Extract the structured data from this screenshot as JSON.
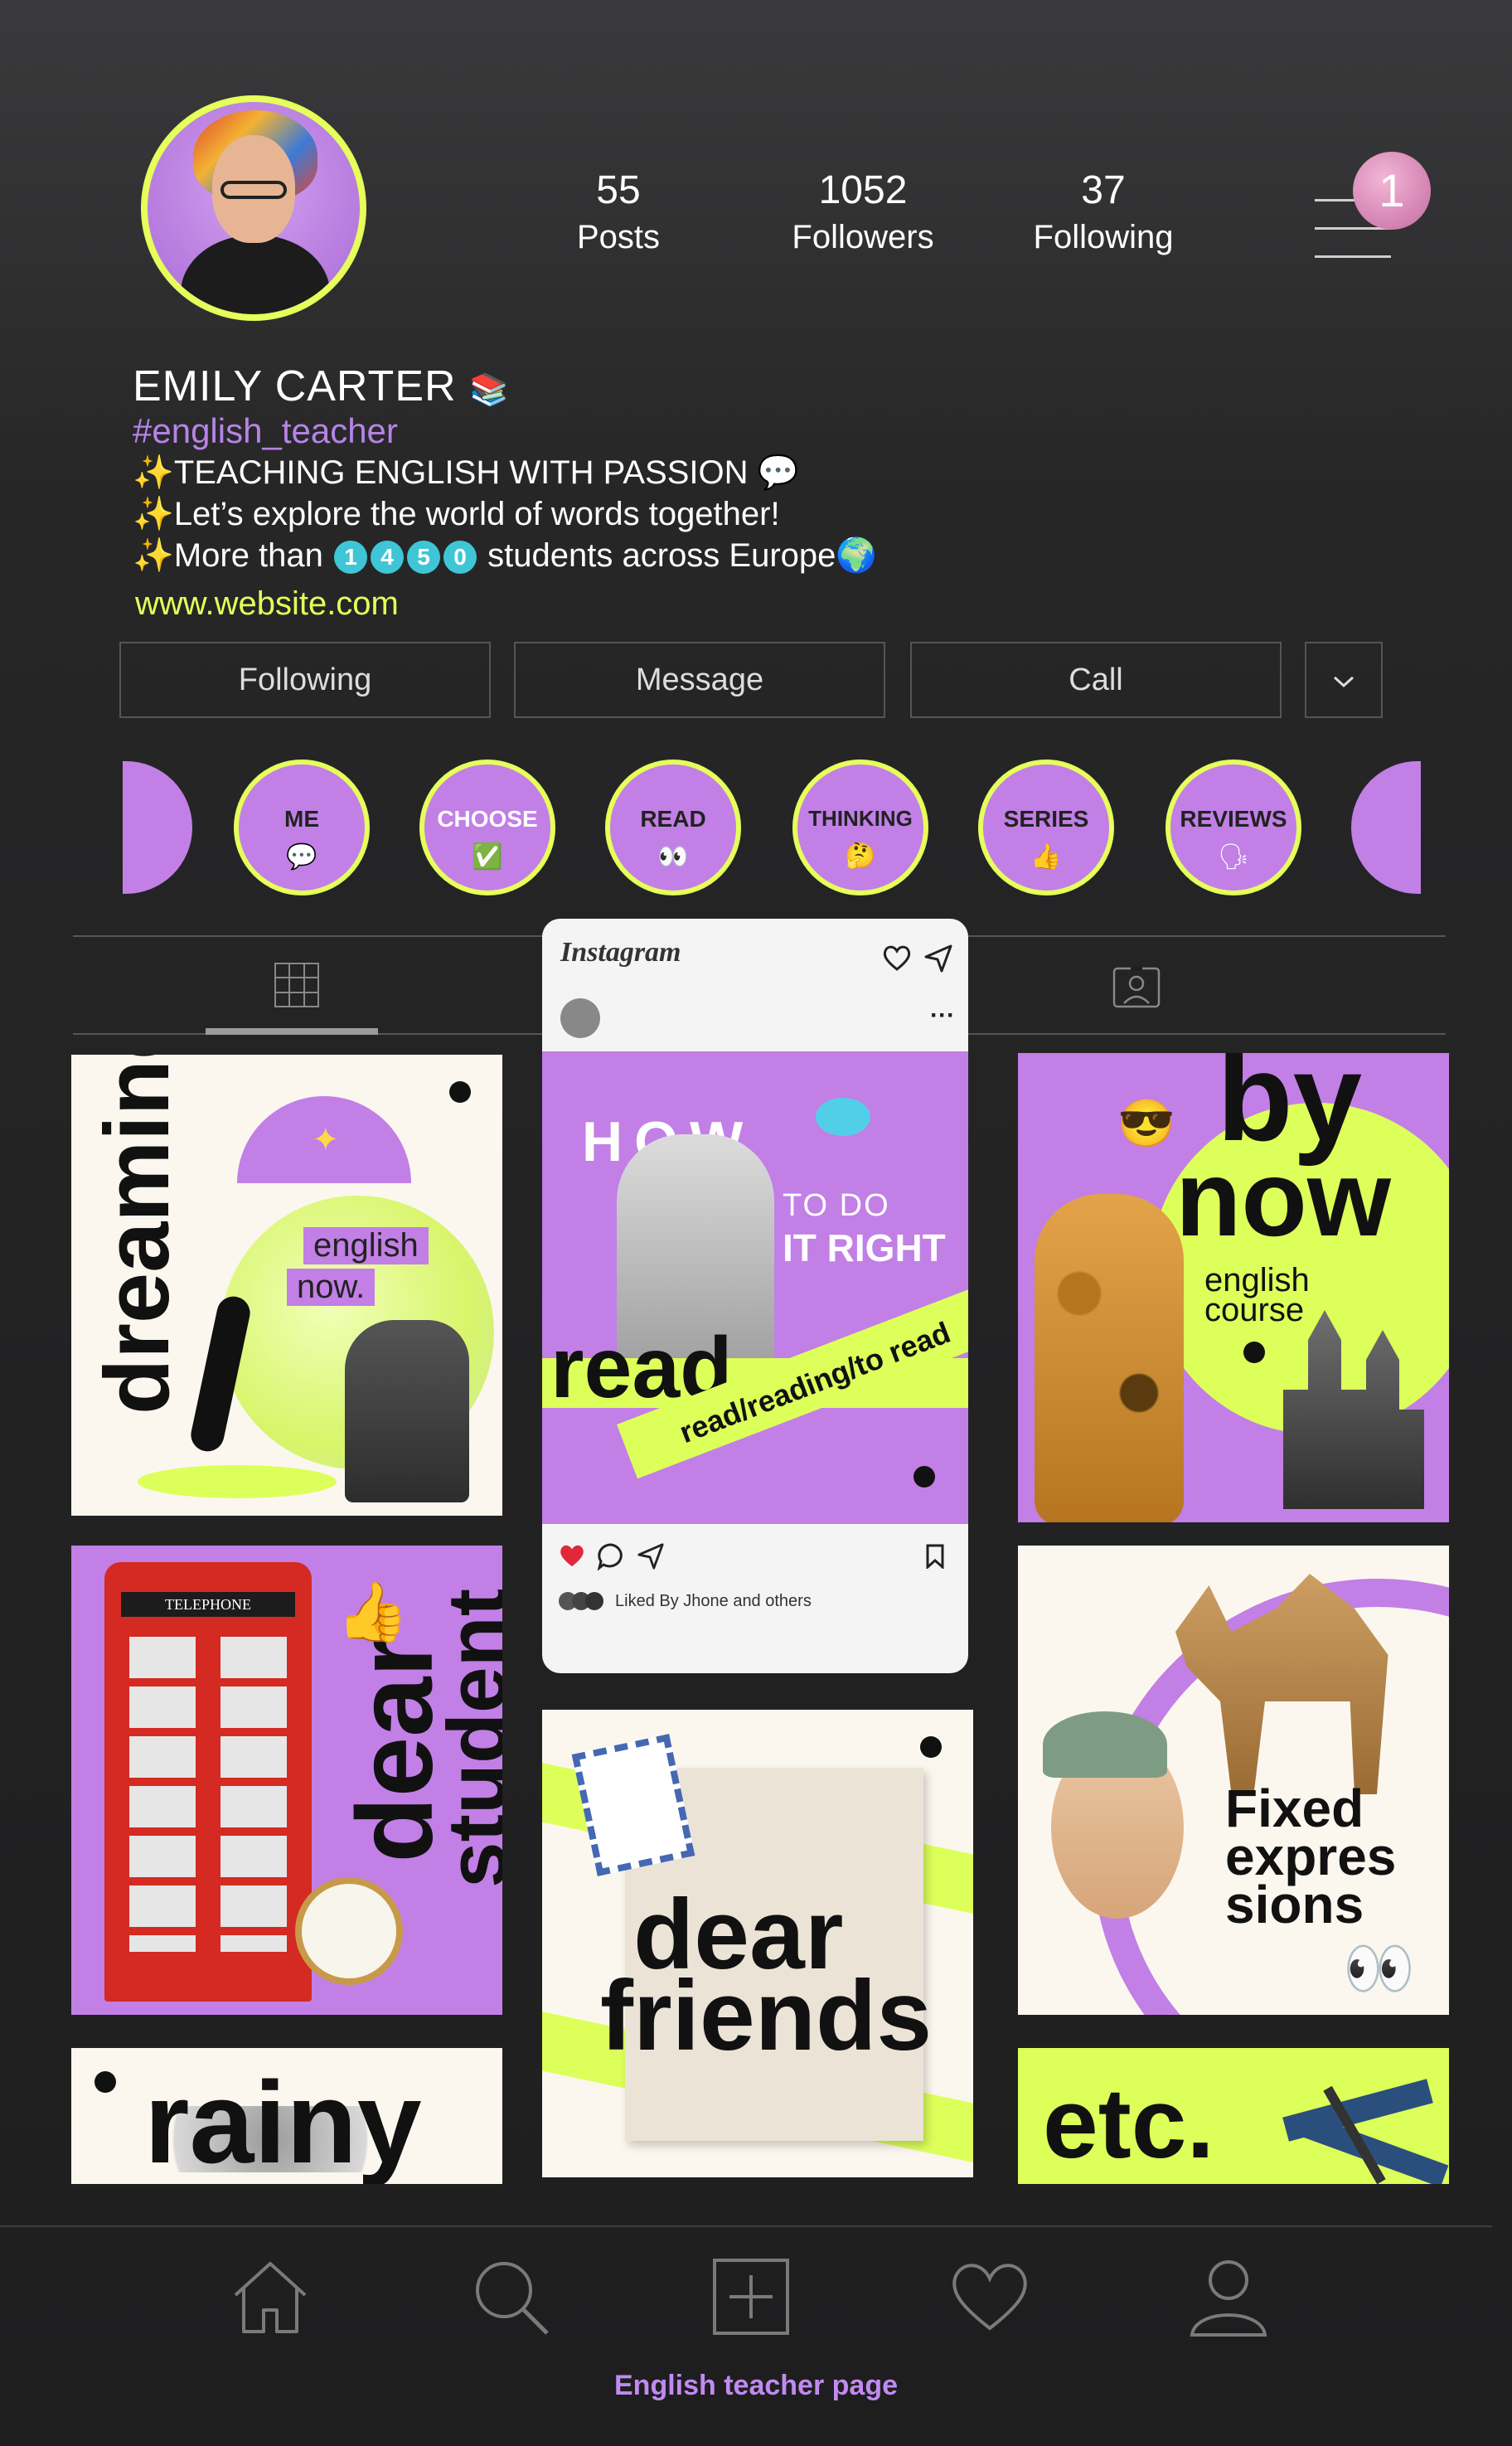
{
  "profile": {
    "name": "EMILY CARTER",
    "name_emoji": "📚",
    "hashtag": "#english_teacher",
    "bio_line1": "TEACHING ENGLISH WITH PASSION",
    "bio_line1_emoji": "💬",
    "bio_line2": "Let’s explore the world of words together!",
    "bio_line3_pre": "More than",
    "bio_line3_digits": [
      "1",
      "4",
      "5",
      "0"
    ],
    "bio_line3_post": "students across Europe",
    "bio_line3_emoji": "🌍",
    "sparkle": "✨",
    "website": "www.website.com"
  },
  "stats": [
    {
      "value": "55",
      "label": "Posts"
    },
    {
      "value": "1052",
      "label": "Followers"
    },
    {
      "value": "37",
      "label": "Following"
    }
  ],
  "notification_count": "1",
  "buttons": {
    "following": "Following",
    "message": "Message",
    "call": "Call",
    "more": "⌄"
  },
  "highlights": [
    {
      "label": "ME",
      "icon": "💬"
    },
    {
      "label": "CHOOSE",
      "icon": "✅"
    },
    {
      "label": "READ",
      "icon": "👀"
    },
    {
      "label": "THINKING",
      "icon": "🤔"
    },
    {
      "label": "SERIES",
      "icon": "👍"
    },
    {
      "label": "REVIEWS",
      "icon": "🗣"
    }
  ],
  "post_card": {
    "brand": "Instagram",
    "title_how": "HOW",
    "to_do": "TO DO",
    "it_right": "IT RIGHT",
    "read": "read",
    "banner": "read/reading/to read",
    "liked_by": "Liked By Jhone and others"
  },
  "tiles": {
    "dreaming": "dreaming",
    "english_now_1": "english",
    "english_now_2": "now.",
    "by": "by",
    "now": "now",
    "english_course_1": "english",
    "english_course_2": "course",
    "dear": "dear",
    "student": "student",
    "dear_friends_1": "dear",
    "dear_friends_2": "friends",
    "fixed_1": "Fixed",
    "fixed_2": "expres",
    "fixed_3": "sions",
    "rainy": "rainy",
    "etc": "etc.",
    "telephone": "TELEPHONE"
  },
  "footer": {
    "label": "English teacher page"
  },
  "colors": {
    "accent_purple": "#c27fe6",
    "accent_lime": "#e6ff5a",
    "hashtag": "#b784e6"
  }
}
